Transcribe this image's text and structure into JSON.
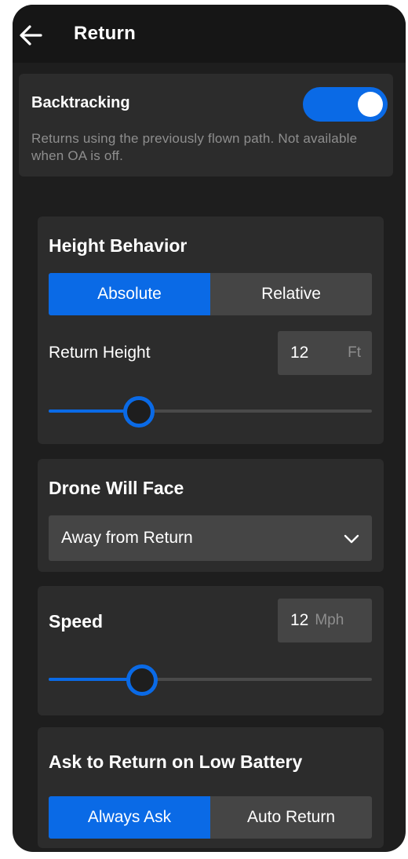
{
  "header": {
    "title": "Return"
  },
  "colors": {
    "accent": "#0a6ae6",
    "card": "#2c2c2c",
    "control": "#454545"
  },
  "backtracking": {
    "label": "Backtracking",
    "description": "Returns using the previously flown path. Not available when OA is off.",
    "enabled": true
  },
  "height_behavior": {
    "title": "Height Behavior",
    "options": [
      "Absolute",
      "Relative"
    ],
    "selected": "Absolute",
    "return_height_label": "Return Height",
    "return_height_value": "12",
    "return_height_unit": "Ft",
    "slider_level": 0.28
  },
  "drone_face": {
    "title": "Drone Will Face",
    "selected": "Away from Return"
  },
  "speed": {
    "title": "Speed",
    "value": "12",
    "unit": "Mph",
    "slider_level": 0.29
  },
  "low_battery": {
    "title": "Ask to Return on Low Battery",
    "options": [
      "Always Ask",
      "Auto Return"
    ],
    "selected": "Always Ask"
  }
}
